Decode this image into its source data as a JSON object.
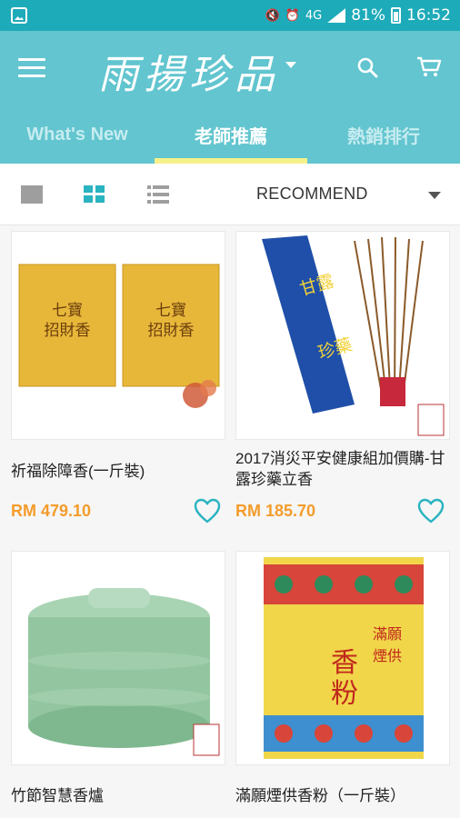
{
  "status_bar": {
    "battery": "81%",
    "time": "16:52",
    "network": "4G"
  },
  "app_bar": {
    "logo_text": "雨揚珍品"
  },
  "tabs": [
    {
      "label": "What's New"
    },
    {
      "label": "老師推薦"
    },
    {
      "label": "熱銷排行"
    }
  ],
  "toolbar": {
    "sort_label": "RECOMMEND"
  },
  "products": [
    {
      "name": "祈福除障香(一斤裝)",
      "price": "RM 479.10"
    },
    {
      "name": "2017消災平安健康組加價購-甘露珍藥立香",
      "price": "RM 185.70"
    },
    {
      "name": "竹節智慧香爐"
    },
    {
      "name": "滿願煙供香粉（一斤裝）"
    }
  ],
  "colors": {
    "status_bar": "#1eabb9",
    "app_bar": "#62c5cf",
    "tab_indicator": "#f5f08a",
    "price": "#f39c2b",
    "accent": "#2ab3c0"
  }
}
